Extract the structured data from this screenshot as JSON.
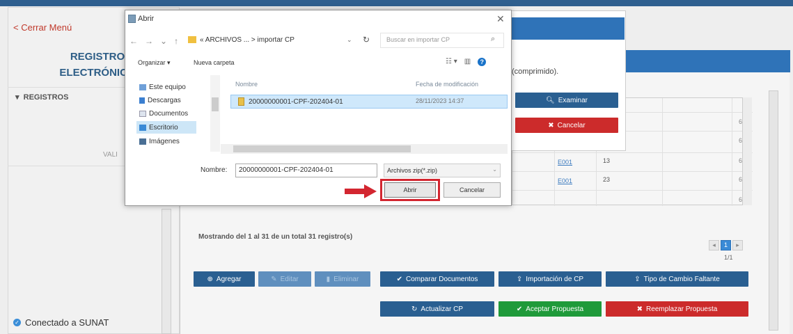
{
  "background_app": {
    "close_menu": "< Cerrar Menú",
    "title_line1": "REGISTROS",
    "title_line2": "ELECTRÓNICOS",
    "section": "REGISTROS",
    "vali_fragment": "VALI",
    "connected": "Conectado a SUNAT",
    "modal_text": "(comprimido).",
    "examinar_label": "Examinar",
    "cancelar_label": "Cancelar",
    "grid_rows": [
      {
        "code": "",
        "num": "",
        "val": "6"
      },
      {
        "code": "",
        "num": "",
        "val": "6"
      },
      {
        "code": "E001",
        "num": "13",
        "val": "6"
      },
      {
        "code": "E001",
        "num": "23",
        "val": "6"
      },
      {
        "code": "",
        "num": "",
        "val": "6"
      }
    ],
    "showing_text": "Mostrando del 1 al 31 de un total 31 registro(s)",
    "current_page": "1",
    "page_info": "1/1",
    "buttons_row1": {
      "agregar": "Agregar",
      "editar": "Editar",
      "eliminar": "Eliminar",
      "comparar": "Comparar Documentos",
      "importacion": "Importación de CP",
      "tipo_cambio": "Tipo de Cambio Faltante"
    },
    "buttons_row2": {
      "actualizar": "Actualizar CP",
      "aceptar": "Aceptar Propuesta",
      "reemplazar": "Reemplazar Propuesta"
    }
  },
  "dialog": {
    "title": "Abrir",
    "path_prefix": "«  ARCHIVOS ...  >  importar CP",
    "search_placeholder": "Buscar en importar CP",
    "organize": "Organizar ▾",
    "new_folder": "Nueva carpeta",
    "nav_items": [
      "Este equipo",
      "Descargas",
      "Documentos",
      "Escritorio",
      "Imágenes"
    ],
    "selected_nav": "Escritorio",
    "col_name": "Nombre",
    "col_date": "Fecha de modificación",
    "file_name": "20000000001-CPF-202404-01",
    "file_date": "28/11/2023 14:37",
    "name_label": "Nombre:",
    "name_value": "20000000001-CPF-202404-01",
    "file_type": "Archivos zip(*.zip)",
    "open_button": "Abrir",
    "cancel_button": "Cancelar"
  },
  "colors": {
    "primary_blue": "#2a5f91",
    "header_blue": "#2f73b8",
    "green": "#1f9a3a",
    "red": "#cc2b2b",
    "highlight_red": "#d32630",
    "selection": "#cfe8fb"
  }
}
